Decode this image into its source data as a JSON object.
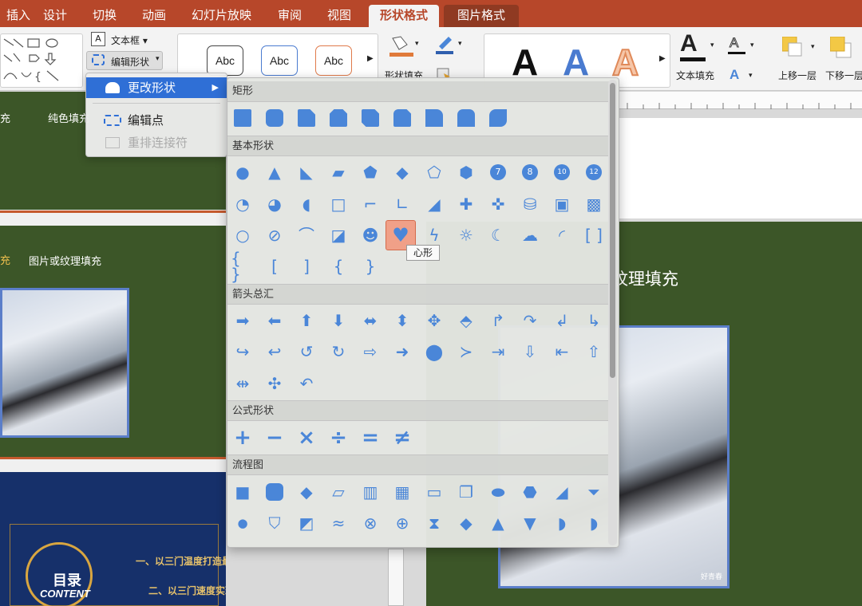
{
  "ribbon": {
    "tabs": [
      {
        "label": "插入"
      },
      {
        "label": "设计"
      },
      {
        "label": "切换"
      },
      {
        "label": "动画"
      },
      {
        "label": "幻灯片放映"
      },
      {
        "label": "审阅"
      },
      {
        "label": "视图"
      },
      {
        "label": "形状格式"
      },
      {
        "label": "图片格式"
      }
    ],
    "text_box_label": "文本框",
    "edit_shape_label": "编辑形状",
    "style_sample": "Abc",
    "shape_fill_label": "形状填充",
    "wordart_letter": "A",
    "text_fill_label": "文本填充",
    "bring_forward_label": "上移一层",
    "send_backward_label": "下移一层",
    "colors": {
      "accent": "#b7472a",
      "highlight": "#2f6fd6",
      "shape": "#4a86d8"
    }
  },
  "menu": {
    "change_shape": "更改形状",
    "edit_points": "编辑点",
    "reroute_connectors": "重排连接符"
  },
  "gallery": {
    "sections": [
      {
        "title": "矩形"
      },
      {
        "title": "基本形状"
      },
      {
        "title": "箭头总汇"
      },
      {
        "title": "公式形状"
      },
      {
        "title": "流程图"
      }
    ],
    "tooltip": "心形",
    "glyphs": {
      "g1": "●",
      "g2": "▲",
      "g3": "◣",
      "g4": "▰",
      "g5": "⬟",
      "g6": "◆",
      "g7": "⬠",
      "g8": "⬢",
      "g9": "7",
      "g10": "8",
      "g11": "10",
      "g12": "12",
      "b1": "◔",
      "b2": "◕",
      "b3": "◖",
      "b4": "□",
      "b5": "⌐",
      "b6": "∟",
      "b7": "◢",
      "b8": "✚",
      "b9": "✜",
      "b10": "⛁",
      "b11": "▣",
      "b12": "▩",
      "c1": "○",
      "c2": "⊘",
      "c3": "⌒",
      "c4": "◪",
      "c5": "☻",
      "c6": "♥",
      "c7": "ϟ",
      "c8": "☼",
      "c9": "☾",
      "c10": "☁",
      "c11": "◜",
      "c12": "[ ]",
      "d1": "{ }",
      "d2": "[",
      "d3": "]",
      "d4": "{",
      "d5": "}",
      "a1": "➡",
      "a2": "⬅",
      "a3": "⬆",
      "a4": "⬇",
      "a5": "⬌",
      "a6": "⬍",
      "a7": "✥",
      "a8": "⬘",
      "a9": "↱",
      "a10": "↷",
      "a11": "↲",
      "a12": "↳",
      "e1": "↪",
      "e2": "↩",
      "e3": "↺",
      "e4": "↻",
      "e5": "⇨",
      "e6": "➜",
      "e7": "⬤",
      "e8": "≻",
      "e9": "⇥",
      "e10": "⇩",
      "e11": "⇤",
      "e12": "⇧",
      "f1": "⇹",
      "f2": "✣",
      "f3": "↶",
      "m1": "+",
      "m2": "−",
      "m3": "×",
      "m4": "÷",
      "m5": "=",
      "m6": "≠",
      "p1": "■",
      "p2": "▢",
      "p3": "◆",
      "p4": "▱",
      "p5": "▥",
      "p6": "▦",
      "p7": "▭",
      "p8": "❐",
      "p9": "⬬",
      "p10": "⬣",
      "p11": "◢",
      "p12": "⏷",
      "q1": "●",
      "q2": "⛉",
      "q3": "◩",
      "q4": "≈",
      "q5": "⊗",
      "q6": "⊕",
      "q7": "⧗",
      "q8": "◆",
      "q9": "▲",
      "q10": "▼",
      "q11": "◗",
      "q12": "◗"
    }
  },
  "slides": {
    "slide1_left": "充",
    "slide1_solid_fill": "纯色填充",
    "slide2_marker": "充",
    "slide2_picture_fill": "图片或纹理填充",
    "main_heading": "纹理填充",
    "toc_title": "目录",
    "toc_subtitle": "CONTENT",
    "toc_item1": "一、以三门温度打造最优人才生态",
    "toc_item2": "二、以三门速度实现高效服务",
    "watermark": "好青春"
  }
}
